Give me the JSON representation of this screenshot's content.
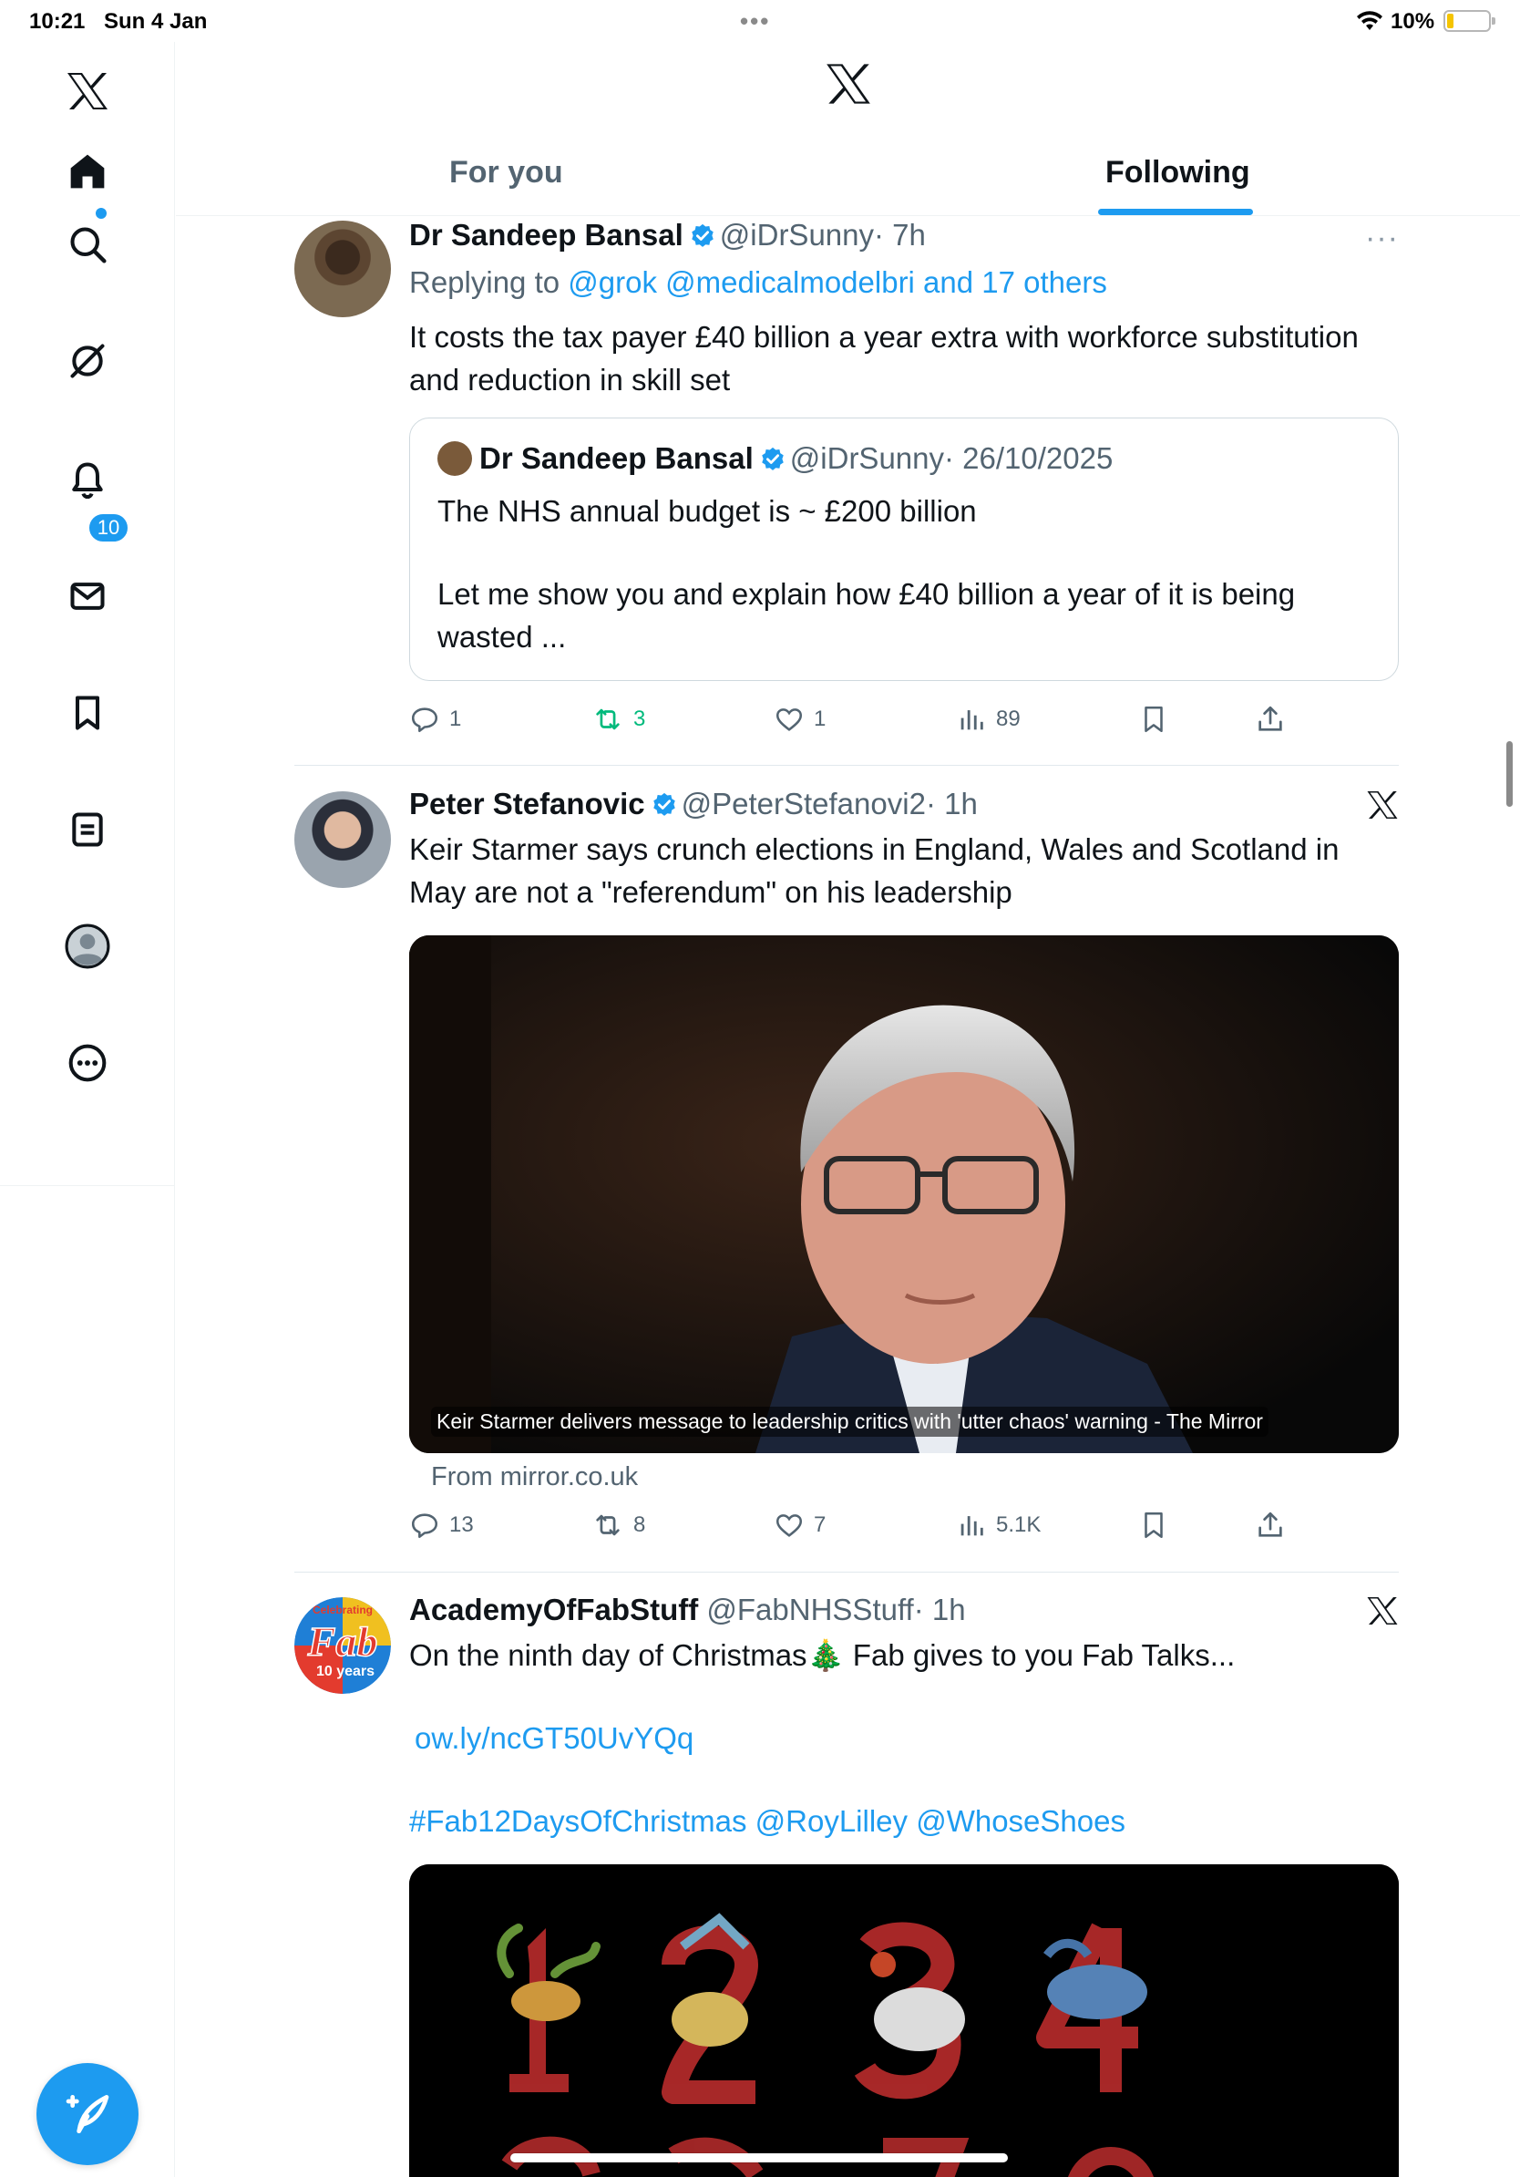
{
  "status_bar": {
    "time": "10:21",
    "date": "Sun 4 Jan",
    "battery": "10%"
  },
  "sidebar": {
    "items": [
      {
        "name": "x-logo-icon"
      },
      {
        "name": "home-icon"
      },
      {
        "name": "search-icon"
      },
      {
        "name": "grok-icon"
      },
      {
        "name": "notifications-icon",
        "badge": "10"
      },
      {
        "name": "messages-icon"
      },
      {
        "name": "bookmarks-icon"
      },
      {
        "name": "lists-icon"
      },
      {
        "name": "profile-icon"
      },
      {
        "name": "more-icon"
      }
    ],
    "compose": "compose-icon"
  },
  "header": {
    "tabs": [
      {
        "label": "For you"
      },
      {
        "label": "Following"
      }
    ],
    "active_tab": "Following"
  },
  "feed": {
    "posts": [
      {
        "name": "Dr Sandeep Bansal",
        "handle": "@iDrSunny",
        "time": "· 7h",
        "reply_prefix": "Replying to ",
        "reply_targets": "@grok @medicalmodelbri and 17 others",
        "text": "It costs the tax payer £40 billion a year extra with workforce substitution and reduction in skill set",
        "quote": {
          "name": "Dr Sandeep Bansal",
          "handle": "@iDrSunny",
          "date": "· 26/10/2025",
          "text_1": "The NHS annual budget is ~ £200 billion",
          "text_2": "Let me show you and explain how £40 billion a year of it is being wasted ..."
        },
        "replies": "1",
        "reposts": "3",
        "likes": "1",
        "views": "89"
      },
      {
        "name": "Peter Stefanovic",
        "handle": "@PeterStefanovi2",
        "time": "· 1h",
        "text": "Keir Starmer says crunch elections in England, Wales and Scotland in May are not a \"referendum\" on his leadership",
        "card_caption": "Keir Starmer delivers message to leadership critics with 'utter chaos' warning - The Mirror",
        "card_source": "From mirror.co.uk",
        "replies": "13",
        "reposts": "8",
        "likes": "7",
        "views": "5.1K"
      },
      {
        "name": "AcademyOfFabStuff",
        "handle": "@FabNHSStuff",
        "time": "· 1h",
        "text_part1": "On the ninth day of Christmas",
        "emoji": "🎄",
        "text_part2": " Fab gives to you Fab Talks...",
        "link": "ow.ly/ncGT50UvYQq",
        "hashtag": "#Fab12DaysOfChristmas",
        "mention_1": "@RoyLilley",
        "mention_2": "@WhoseShoes",
        "avatar_text_1": "Celebrating",
        "avatar_text_2": "Fab",
        "avatar_text_3": "10 years"
      }
    ]
  }
}
